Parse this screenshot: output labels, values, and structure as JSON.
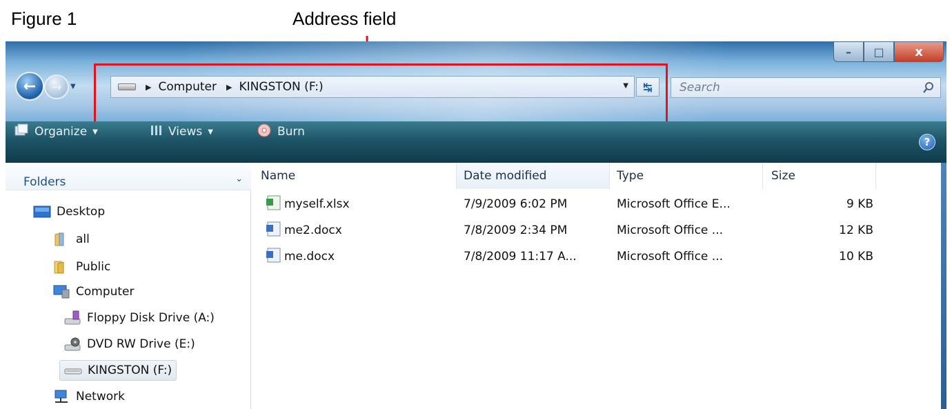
{
  "figure_label": "Figure 1",
  "callout": {
    "label": "Address field",
    "color": "#e0141a"
  },
  "window": {
    "buttons": {
      "minimize": "–",
      "maximize": "□",
      "close": "x"
    },
    "address": {
      "crumbs": [
        "Computer",
        "KINGSTON (F:)"
      ]
    },
    "search": {
      "placeholder": "Search"
    },
    "toolbar": {
      "organize": "Organize",
      "views": "Views",
      "burn": "Burn",
      "help": "?"
    }
  },
  "sidebar": {
    "title": "Folders",
    "items": [
      {
        "label": "Desktop",
        "icon": "desktop-icon"
      },
      {
        "label": "all",
        "icon": "user-folder-icon"
      },
      {
        "label": "Public",
        "icon": "folder-icon"
      },
      {
        "label": "Computer",
        "icon": "computer-icon"
      },
      {
        "label": "Floppy Disk Drive (A:)",
        "icon": "floppy-drive-icon"
      },
      {
        "label": "DVD RW Drive (E:)",
        "icon": "dvd-drive-icon"
      },
      {
        "label": "KINGSTON (F:)",
        "icon": "usb-drive-icon",
        "selected": true
      },
      {
        "label": "Network",
        "icon": "network-icon"
      }
    ]
  },
  "file_list": {
    "columns": [
      "Name",
      "Date modified",
      "Type",
      "Size"
    ],
    "sorted_column": "Date modified",
    "rows": [
      {
        "name": "myself.xlsx",
        "date": "7/9/2009 6:02 PM",
        "type": "Microsoft Office E...",
        "size": "9 KB",
        "icon": "excel-file-icon"
      },
      {
        "name": "me2.docx",
        "date": "7/8/2009 2:34 PM",
        "type": "Microsoft Office ...",
        "size": "12 KB",
        "icon": "word-file-icon"
      },
      {
        "name": "me.docx",
        "date": "7/8/2009 11:17 A...",
        "type": "Microsoft Office ...",
        "size": "10 KB",
        "icon": "word-file-icon"
      }
    ]
  }
}
